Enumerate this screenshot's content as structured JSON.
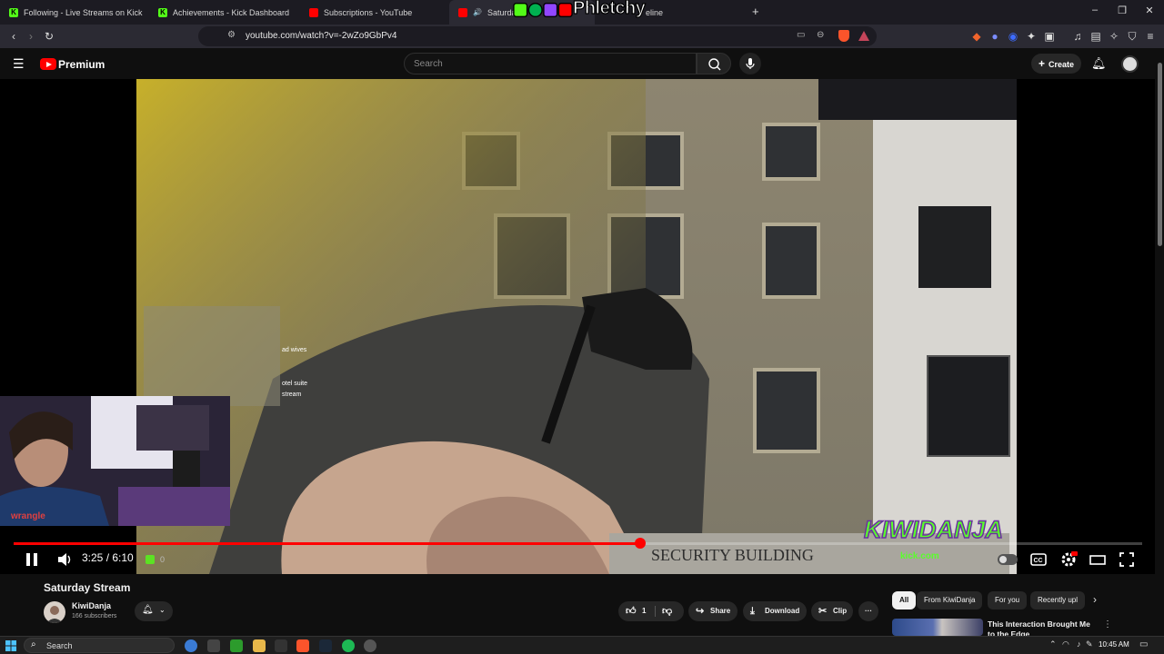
{
  "browser": {
    "tabs": [
      {
        "title": "Following - Live Streams on Kick",
        "favicon": "kick-icon",
        "color": "#53fc18"
      },
      {
        "title": "Achievements - Kick Dashboard",
        "favicon": "kick-icon",
        "color": "#53fc18"
      },
      {
        "title": "Subscriptions - YouTube",
        "favicon": "youtube-icon",
        "color": "#ff0000"
      },
      {
        "title": "Saturda",
        "favicon": "youtube-icon",
        "color": "#ff0000"
      },
      {
        "title": "eline",
        "favicon": "generic-icon",
        "color": "#888888"
      }
    ],
    "new_tab": "+",
    "url": "youtube.com/watch?v=-2wZo9GbPv4"
  },
  "overlay": {
    "brand_text": "Phletchy"
  },
  "youtube": {
    "brand": "Premium",
    "search_placeholder": "Search",
    "create_label": "Create",
    "video": {
      "title": "Saturday Stream",
      "current_time": "3:25",
      "duration": "6:10",
      "time_display": "3:25 / 6:10",
      "progress_fraction": 0.555,
      "chat_fragments": [
        "ad wives",
        "otel suite",
        "stream"
      ],
      "watermark_text": "KIWIDANJA",
      "watermark_sub": "kick.com",
      "sign_text": "SECURITY BUILDING",
      "webcam_overlay": "0"
    },
    "channel": {
      "name": "KiwiDanja",
      "subscribers": "166 subscribers"
    },
    "actions": {
      "like_count": "1",
      "share": "Share",
      "download": "Download",
      "clip": "Clip"
    },
    "chips": [
      "All",
      "From KiwiDanja",
      "For you",
      "Recently upl"
    ],
    "recommendation": {
      "title": "This Interaction Brought Me to the Edge"
    }
  },
  "taskbar": {
    "search_placeholder": "Search",
    "clock": "10:45 AM"
  }
}
